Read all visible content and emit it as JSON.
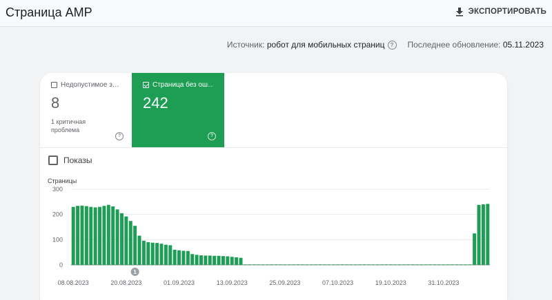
{
  "header": {
    "title": "Страница AMP",
    "export_label": "ЭКСПОРТИРОВАТЬ"
  },
  "meta": {
    "source_label": "Источник:",
    "source_value": "робот для мобильных страниц",
    "updated_label": "Последнее обновление:",
    "updated_value": "05.11.2023"
  },
  "tiles": {
    "invalid": {
      "label": "Недопустимое з…",
      "count": "8",
      "sub": "1 критичная проблема"
    },
    "valid": {
      "label": "Страница без ош…",
      "count": "242",
      "color": "#1e9e55"
    }
  },
  "impressions_label": "Показы",
  "chart_data": {
    "type": "bar",
    "ylabel": "Страницы",
    "ylim": [
      0,
      300
    ],
    "yticks": [
      0,
      100,
      200,
      300
    ],
    "xtick_labels": [
      "08.08.2023",
      "20.08.2023",
      "01.09.2023",
      "13.09.2023",
      "25.09.2023",
      "07.10.2023",
      "19.10.2023",
      "31.10.2023"
    ],
    "xtick_index": [
      0,
      12,
      24,
      36,
      48,
      60,
      72,
      84
    ],
    "annotation": {
      "label": "1",
      "index": 14
    },
    "color": "#1e9e55",
    "values": [
      230,
      234,
      235,
      233,
      230,
      228,
      230,
      234,
      238,
      232,
      220,
      205,
      192,
      174,
      155,
      116,
      96,
      90,
      88,
      87,
      84,
      80,
      78,
      60,
      58,
      56,
      55,
      43,
      40,
      38,
      37,
      37,
      36,
      36,
      35,
      34,
      32,
      30,
      28,
      2,
      2,
      2,
      2,
      2,
      2,
      2,
      2,
      2,
      2,
      2,
      2,
      2,
      2,
      2,
      2,
      2,
      2,
      2,
      2,
      2,
      2,
      2,
      2,
      2,
      2,
      2,
      2,
      2,
      2,
      2,
      2,
      2,
      2,
      2,
      2,
      2,
      2,
      2,
      2,
      2,
      2,
      2,
      2,
      2,
      2,
      2,
      2,
      2,
      2,
      2,
      2,
      125,
      238,
      240,
      242
    ]
  }
}
